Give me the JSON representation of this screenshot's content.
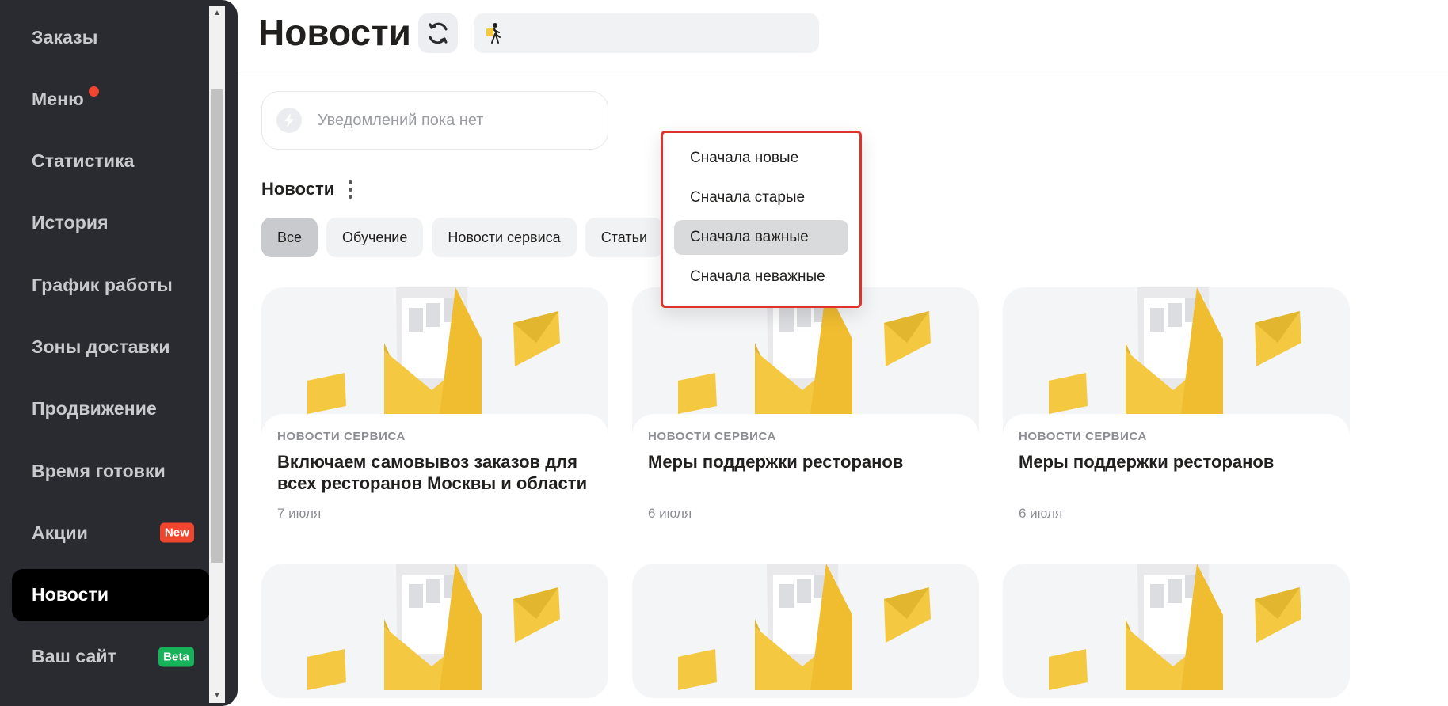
{
  "sidebar": {
    "items": [
      {
        "label": "Заказы"
      },
      {
        "label": "Меню"
      },
      {
        "label": "Статистика"
      },
      {
        "label": "История"
      },
      {
        "label": "График работы"
      },
      {
        "label": "Зоны доставки"
      },
      {
        "label": "Продвижение"
      },
      {
        "label": "Время готовки"
      },
      {
        "label": "Акции",
        "badge": "New"
      },
      {
        "label": "Новости"
      },
      {
        "label": "Ваш сайт",
        "badge": "Beta"
      }
    ],
    "active_item": "Новости"
  },
  "header": {
    "title": "Новости",
    "search_value": ""
  },
  "notifications": {
    "empty_text": "Уведомлений пока нет"
  },
  "news": {
    "section_title": "Новости",
    "filters": [
      {
        "label": "Все",
        "active": true
      },
      {
        "label": "Обучение"
      },
      {
        "label": "Новости сервиса"
      },
      {
        "label": "Статьи"
      }
    ],
    "sort_menu": {
      "options": [
        {
          "label": "Сначала новые"
        },
        {
          "label": "Сначала старые"
        },
        {
          "label": "Сначала важные",
          "highlighted": true
        },
        {
          "label": "Сначала неважные"
        }
      ]
    },
    "cards": [
      {
        "category": "Новости сервиса",
        "title": "Включаем самовывоз заказов для всех ресторанов Москвы и области",
        "date": "7 июля"
      },
      {
        "category": "Новости сервиса",
        "title": "Меры поддержки ресторанов",
        "date": "6 июля"
      },
      {
        "category": "Новости сервиса",
        "title": "Меры поддержки ресторанов",
        "date": "6 июля"
      }
    ]
  },
  "colors": {
    "sidebar_bg": "#2a2b30",
    "active_nav_bg": "#000000",
    "accent_red": "#f0452e",
    "beta_green": "#16b35a",
    "dropdown_outline": "#e0312b",
    "envelope_yellow": "#f5c842"
  }
}
